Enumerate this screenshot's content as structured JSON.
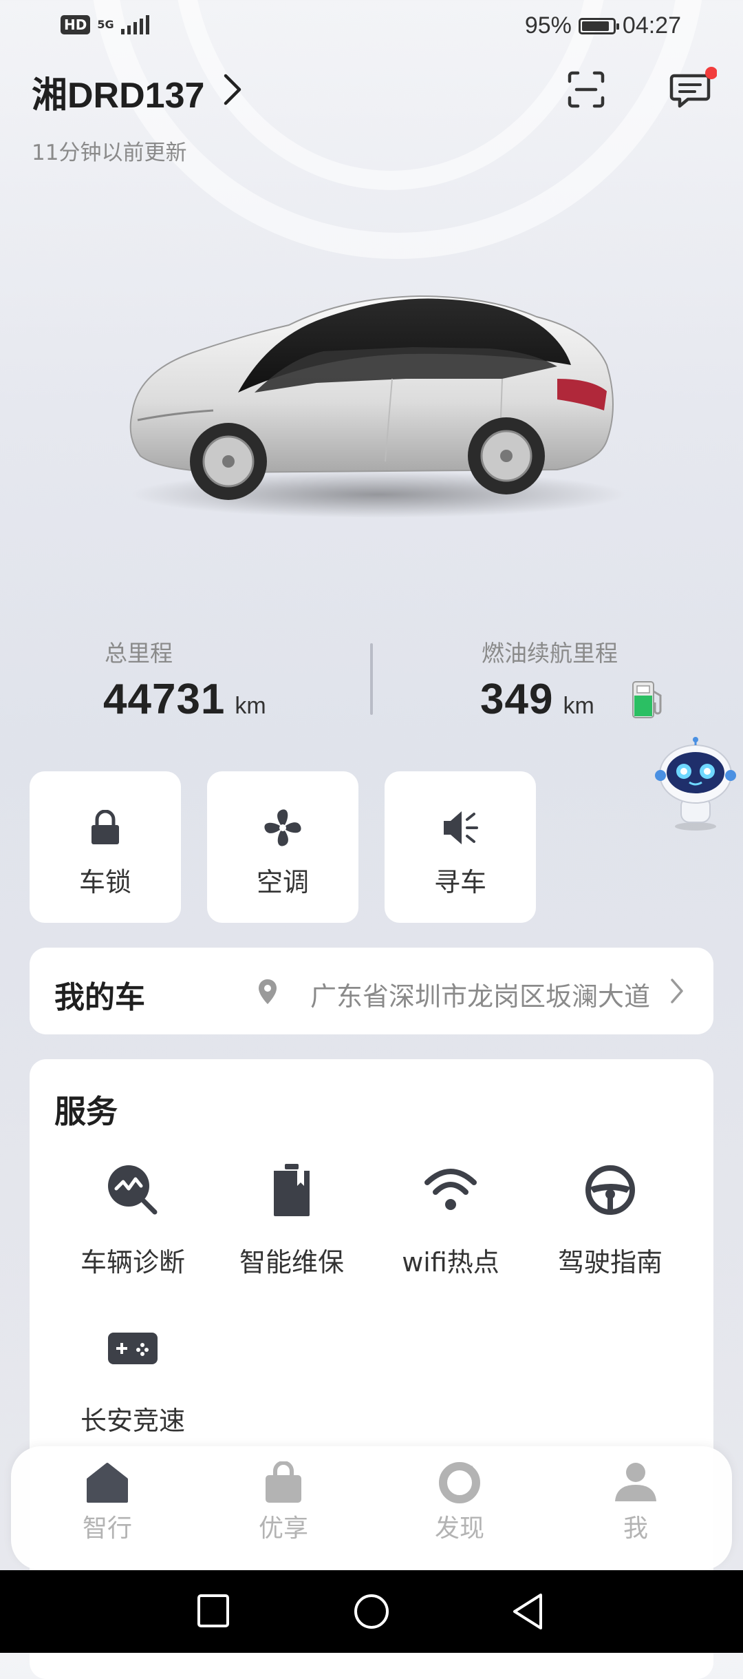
{
  "status_bar": {
    "network_badge": "HD",
    "network_type": "5G",
    "battery": "95%",
    "battery_level": 0.95,
    "time": "04:27"
  },
  "header": {
    "plate": "湘DRD137",
    "updated": "11分钟以前更新",
    "icons": [
      "scan-icon",
      "message-icon"
    ],
    "message_badge_color": "#f23c3c"
  },
  "stats": {
    "total": {
      "label": "总里程",
      "value": "44731",
      "unit": "km"
    },
    "range": {
      "label": "燃油续航里程",
      "value": "349",
      "unit": "km",
      "fuel_color": "#2bbf63"
    }
  },
  "quick_actions": [
    {
      "label": "车锁",
      "icon": "lock-icon"
    },
    {
      "label": "空调",
      "icon": "fan-icon"
    },
    {
      "label": "寻车",
      "icon": "speaker-icon"
    }
  ],
  "my_car": {
    "title": "我的车",
    "address": "广东省深圳市龙岗区坂澜大道",
    "icon": "location-pin-icon"
  },
  "services": {
    "title": "服务",
    "items": [
      {
        "label": "车辆诊断",
        "icon": "diagnosis-icon"
      },
      {
        "label": "智能维保",
        "icon": "maintenance-icon"
      },
      {
        "label": "wifi热点",
        "icon": "wifi-icon"
      },
      {
        "label": "驾驶指南",
        "icon": "steering-wheel-icon"
      },
      {
        "label": "长安竞速",
        "icon": "gamepad-icon"
      }
    ]
  },
  "tabs": [
    {
      "label": "智行",
      "icon": "home-icon"
    },
    {
      "label": "优享",
      "icon": "shopping-bag-icon"
    },
    {
      "label": "发现",
      "icon": "discover-icon"
    },
    {
      "label": "我",
      "icon": "user-icon"
    }
  ],
  "colors": {
    "icon_dark": "#3d4048",
    "tab_inactive": "#b3b3b3",
    "tab_active_icon": "#4a4e58"
  }
}
